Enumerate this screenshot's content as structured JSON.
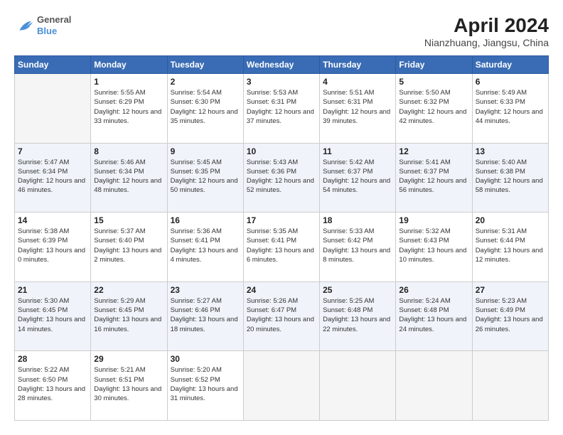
{
  "header": {
    "logo_line1": "General",
    "logo_line2": "Blue",
    "title": "April 2024",
    "subtitle": "Nianzhuang, Jiangsu, China"
  },
  "weekdays": [
    "Sunday",
    "Monday",
    "Tuesday",
    "Wednesday",
    "Thursday",
    "Friday",
    "Saturday"
  ],
  "weeks": [
    [
      {
        "day": "",
        "info": ""
      },
      {
        "day": "1",
        "info": "Sunrise: 5:55 AM\nSunset: 6:29 PM\nDaylight: 12 hours\nand 33 minutes."
      },
      {
        "day": "2",
        "info": "Sunrise: 5:54 AM\nSunset: 6:30 PM\nDaylight: 12 hours\nand 35 minutes."
      },
      {
        "day": "3",
        "info": "Sunrise: 5:53 AM\nSunset: 6:31 PM\nDaylight: 12 hours\nand 37 minutes."
      },
      {
        "day": "4",
        "info": "Sunrise: 5:51 AM\nSunset: 6:31 PM\nDaylight: 12 hours\nand 39 minutes."
      },
      {
        "day": "5",
        "info": "Sunrise: 5:50 AM\nSunset: 6:32 PM\nDaylight: 12 hours\nand 42 minutes."
      },
      {
        "day": "6",
        "info": "Sunrise: 5:49 AM\nSunset: 6:33 PM\nDaylight: 12 hours\nand 44 minutes."
      }
    ],
    [
      {
        "day": "7",
        "info": "Sunrise: 5:47 AM\nSunset: 6:34 PM\nDaylight: 12 hours\nand 46 minutes."
      },
      {
        "day": "8",
        "info": "Sunrise: 5:46 AM\nSunset: 6:34 PM\nDaylight: 12 hours\nand 48 minutes."
      },
      {
        "day": "9",
        "info": "Sunrise: 5:45 AM\nSunset: 6:35 PM\nDaylight: 12 hours\nand 50 minutes."
      },
      {
        "day": "10",
        "info": "Sunrise: 5:43 AM\nSunset: 6:36 PM\nDaylight: 12 hours\nand 52 minutes."
      },
      {
        "day": "11",
        "info": "Sunrise: 5:42 AM\nSunset: 6:37 PM\nDaylight: 12 hours\nand 54 minutes."
      },
      {
        "day": "12",
        "info": "Sunrise: 5:41 AM\nSunset: 6:37 PM\nDaylight: 12 hours\nand 56 minutes."
      },
      {
        "day": "13",
        "info": "Sunrise: 5:40 AM\nSunset: 6:38 PM\nDaylight: 12 hours\nand 58 minutes."
      }
    ],
    [
      {
        "day": "14",
        "info": "Sunrise: 5:38 AM\nSunset: 6:39 PM\nDaylight: 13 hours\nand 0 minutes."
      },
      {
        "day": "15",
        "info": "Sunrise: 5:37 AM\nSunset: 6:40 PM\nDaylight: 13 hours\nand 2 minutes."
      },
      {
        "day": "16",
        "info": "Sunrise: 5:36 AM\nSunset: 6:41 PM\nDaylight: 13 hours\nand 4 minutes."
      },
      {
        "day": "17",
        "info": "Sunrise: 5:35 AM\nSunset: 6:41 PM\nDaylight: 13 hours\nand 6 minutes."
      },
      {
        "day": "18",
        "info": "Sunrise: 5:33 AM\nSunset: 6:42 PM\nDaylight: 13 hours\nand 8 minutes."
      },
      {
        "day": "19",
        "info": "Sunrise: 5:32 AM\nSunset: 6:43 PM\nDaylight: 13 hours\nand 10 minutes."
      },
      {
        "day": "20",
        "info": "Sunrise: 5:31 AM\nSunset: 6:44 PM\nDaylight: 13 hours\nand 12 minutes."
      }
    ],
    [
      {
        "day": "21",
        "info": "Sunrise: 5:30 AM\nSunset: 6:45 PM\nDaylight: 13 hours\nand 14 minutes."
      },
      {
        "day": "22",
        "info": "Sunrise: 5:29 AM\nSunset: 6:45 PM\nDaylight: 13 hours\nand 16 minutes."
      },
      {
        "day": "23",
        "info": "Sunrise: 5:27 AM\nSunset: 6:46 PM\nDaylight: 13 hours\nand 18 minutes."
      },
      {
        "day": "24",
        "info": "Sunrise: 5:26 AM\nSunset: 6:47 PM\nDaylight: 13 hours\nand 20 minutes."
      },
      {
        "day": "25",
        "info": "Sunrise: 5:25 AM\nSunset: 6:48 PM\nDaylight: 13 hours\nand 22 minutes."
      },
      {
        "day": "26",
        "info": "Sunrise: 5:24 AM\nSunset: 6:48 PM\nDaylight: 13 hours\nand 24 minutes."
      },
      {
        "day": "27",
        "info": "Sunrise: 5:23 AM\nSunset: 6:49 PM\nDaylight: 13 hours\nand 26 minutes."
      }
    ],
    [
      {
        "day": "28",
        "info": "Sunrise: 5:22 AM\nSunset: 6:50 PM\nDaylight: 13 hours\nand 28 minutes."
      },
      {
        "day": "29",
        "info": "Sunrise: 5:21 AM\nSunset: 6:51 PM\nDaylight: 13 hours\nand 30 minutes."
      },
      {
        "day": "30",
        "info": "Sunrise: 5:20 AM\nSunset: 6:52 PM\nDaylight: 13 hours\nand 31 minutes."
      },
      {
        "day": "",
        "info": ""
      },
      {
        "day": "",
        "info": ""
      },
      {
        "day": "",
        "info": ""
      },
      {
        "day": "",
        "info": ""
      }
    ]
  ]
}
